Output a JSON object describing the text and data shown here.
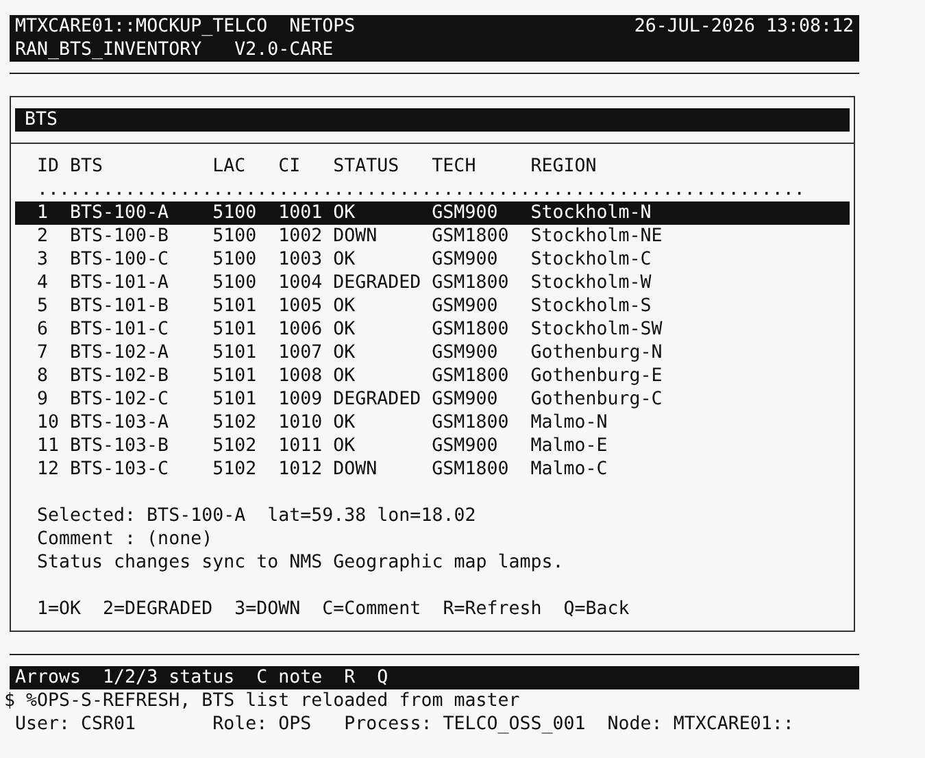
{
  "header": {
    "system": "MTXCARE01::MOCKUP_TELCO",
    "context": "NETOPS",
    "datetime": "26-JUL-2026 13:08:12",
    "app": "RAN_BTS_INVENTORY",
    "version": "V2.0-CARE"
  },
  "panel": {
    "title": "BTS",
    "columns": [
      "ID",
      "BTS",
      "LAC",
      "CI",
      "STATUS",
      "TECH",
      "REGION"
    ],
    "separator": "......................................................................",
    "rows": [
      {
        "cells": [
          "1",
          "BTS-100-A",
          "5100",
          "1001",
          "OK",
          "GSM900",
          "Stockholm-N"
        ],
        "selected": true
      },
      {
        "cells": [
          "2",
          "BTS-100-B",
          "5100",
          "1002",
          "DOWN",
          "GSM1800",
          "Stockholm-NE"
        ],
        "selected": false
      },
      {
        "cells": [
          "3",
          "BTS-100-C",
          "5100",
          "1003",
          "OK",
          "GSM900",
          "Stockholm-C"
        ],
        "selected": false
      },
      {
        "cells": [
          "4",
          "BTS-101-A",
          "5100",
          "1004",
          "DEGRADED",
          "GSM1800",
          "Stockholm-W"
        ],
        "selected": false
      },
      {
        "cells": [
          "5",
          "BTS-101-B",
          "5101",
          "1005",
          "OK",
          "GSM900",
          "Stockholm-S"
        ],
        "selected": false
      },
      {
        "cells": [
          "6",
          "BTS-101-C",
          "5101",
          "1006",
          "OK",
          "GSM1800",
          "Stockholm-SW"
        ],
        "selected": false
      },
      {
        "cells": [
          "7",
          "BTS-102-A",
          "5101",
          "1007",
          "OK",
          "GSM900",
          "Gothenburg-N"
        ],
        "selected": false
      },
      {
        "cells": [
          "8",
          "BTS-102-B",
          "5101",
          "1008",
          "OK",
          "GSM1800",
          "Gothenburg-E"
        ],
        "selected": false
      },
      {
        "cells": [
          "9",
          "BTS-102-C",
          "5101",
          "1009",
          "DEGRADED",
          "GSM900",
          "Gothenburg-C"
        ],
        "selected": false
      },
      {
        "cells": [
          "10",
          "BTS-103-A",
          "5102",
          "1010",
          "OK",
          "GSM1800",
          "Malmo-N"
        ],
        "selected": false
      },
      {
        "cells": [
          "11",
          "BTS-103-B",
          "5102",
          "1011",
          "OK",
          "GSM900",
          "Malmo-E"
        ],
        "selected": false
      },
      {
        "cells": [
          "12",
          "BTS-103-C",
          "5102",
          "1012",
          "DOWN",
          "GSM1800",
          "Malmo-C"
        ],
        "selected": false
      }
    ],
    "details": [
      "Selected: BTS-100-A  lat=59.38 lon=18.02",
      "Comment : (none)",
      "Status changes sync to NMS Geographic map lamps."
    ],
    "keys": "1=OK  2=DEGRADED  3=DOWN  C=Comment  R=Refresh  Q=Back"
  },
  "status_bar": "Arrows  1/2/3 status  C note  R  Q",
  "message": "$ %OPS-S-REFRESH, BTS list reloaded from master",
  "session": [
    "User: CSR01",
    "Role: OPS",
    "Process: TELCO_OSS_001",
    "Node: MTXCARE01::"
  ]
}
